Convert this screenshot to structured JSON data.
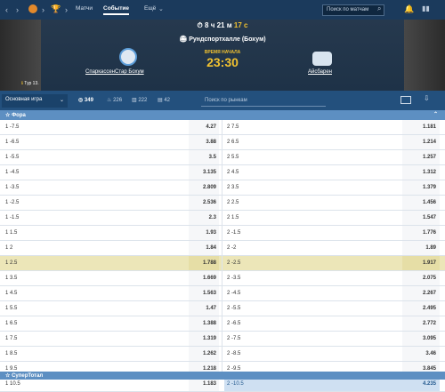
{
  "nav": {
    "matches": "Матчи",
    "event": "Событие",
    "more": "Ещё",
    "search_placeholder": "Поиск по матчам"
  },
  "header": {
    "countdown_h": "8",
    "countdown_h_unit": "ч",
    "countdown_m": "21",
    "countdown_m_unit": "м",
    "countdown_s": "17",
    "countdown_s_unit": "с",
    "venue": "Рундспортхалле (Бохум)",
    "start_label": "ВРЕМЯ НАЧАЛА",
    "start_time": "23:30",
    "team1": "СпаркассенСтар Бохум",
    "team2": "Айсбарен",
    "tour": "Тур 13."
  },
  "bar": {
    "select": "Основная игра",
    "count_all": "349",
    "count_hot": "226",
    "count_stats": "222",
    "count_other": "42",
    "search_placeholder": "Поиск по рынкам"
  },
  "sections": {
    "fora": "Фора",
    "supertotal": "СуперТотал"
  },
  "rows": [
    {
      "l": "1 -7.5",
      "lv": "4.27",
      "r": "2 7.5",
      "rv": "1.181"
    },
    {
      "l": "1 -6.5",
      "lv": "3.88",
      "r": "2 6.5",
      "rv": "1.214"
    },
    {
      "l": "1 -5.5",
      "lv": "3.5",
      "r": "2 5.5",
      "rv": "1.257"
    },
    {
      "l": "1 -4.5",
      "lv": "3.135",
      "r": "2 4.5",
      "rv": "1.312"
    },
    {
      "l": "1 -3.5",
      "lv": "2.809",
      "r": "2 3.5",
      "rv": "1.379"
    },
    {
      "l": "1 -2.5",
      "lv": "2.536",
      "r": "2 2.5",
      "rv": "1.456"
    },
    {
      "l": "1 -1.5",
      "lv": "2.3",
      "r": "2 1.5",
      "rv": "1.547"
    },
    {
      "l": "1 1.5",
      "lv": "1.93",
      "r": "2 -1.5",
      "rv": "1.776"
    },
    {
      "l": "1 2",
      "lv": "1.84",
      "r": "2 -2",
      "rv": "1.89"
    },
    {
      "l": "1 2.5",
      "lv": "1.788",
      "r": "2 -2.5",
      "rv": "1.917"
    },
    {
      "l": "1 3.5",
      "lv": "1.669",
      "r": "2 -3.5",
      "rv": "2.075"
    },
    {
      "l": "1 4.5",
      "lv": "1.563",
      "r": "2 -4.5",
      "rv": "2.267"
    },
    {
      "l": "1 5.5",
      "lv": "1.47",
      "r": "2 -5.5",
      "rv": "2.495"
    },
    {
      "l": "1 6.5",
      "lv": "1.388",
      "r": "2 -6.5",
      "rv": "2.772"
    },
    {
      "l": "1 7.5",
      "lv": "1.319",
      "r": "2 -7.5",
      "rv": "3.095"
    },
    {
      "l": "1 8.5",
      "lv": "1.262",
      "r": "2 -8.5",
      "rv": "3.46"
    },
    {
      "l": "1 9.5",
      "lv": "1.218",
      "r": "2 -9.5",
      "rv": "3.845"
    },
    {
      "l": "1 10.5",
      "lv": "1.183",
      "r": "2 -10.5",
      "rv": "4.235"
    }
  ]
}
